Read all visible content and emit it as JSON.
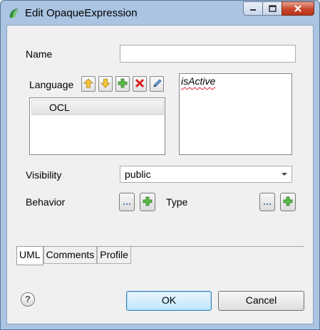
{
  "window": {
    "title": "Edit OpaqueExpression"
  },
  "form": {
    "name_label": "Name",
    "name_value": "",
    "language_label": "Language",
    "languages": [
      "OCL"
    ],
    "expression": "isActive",
    "visibility_label": "Visibility",
    "visibility_value": "public",
    "behavior_label": "Behavior",
    "type_label": "Type"
  },
  "tabs": [
    "UML",
    "Comments",
    "Profile"
  ],
  "buttons": {
    "ok": "OK",
    "cancel": "Cancel",
    "help": "?"
  },
  "icons": {
    "language_tools": [
      "arrow-up-icon",
      "arrow-down-icon",
      "add-icon",
      "delete-icon",
      "edit-icon"
    ],
    "accent": "#3c7fb1"
  }
}
